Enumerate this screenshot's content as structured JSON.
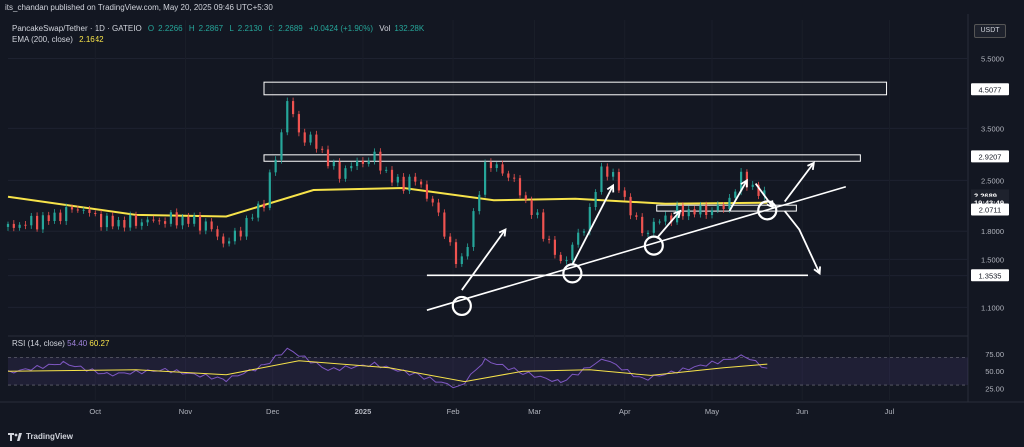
{
  "header": {
    "publisher": "its_chandan published on TradingView.com, May 20, 2025 09:46 UTC+5:30"
  },
  "legend": {
    "symbol": "PancakeSwap/Tether · 1D · GATEIO",
    "o_label": "O",
    "o_value": "2.2266",
    "h_label": "H",
    "h_value": "2.2867",
    "l_label": "L",
    "l_value": "2.2130",
    "c_label": "C",
    "c_value": "2.2689",
    "change": "+0.0424 (+1.90%)",
    "vol_label": "Vol",
    "vol_value": "132.28K",
    "ema_label": "EMA (200, close)",
    "ema_value": "2.1642"
  },
  "currency_badge": "USDT",
  "rsi_legend": {
    "label": "RSI (14, close)",
    "rsi_value": "54.40",
    "ma_value": "60.27"
  },
  "footer": {
    "brand": "TradingView"
  },
  "colors": {
    "background": "#131722",
    "up": "#26a69a",
    "down": "#ef5350",
    "ema": "#f7e34a",
    "rsi": "#7e57c2",
    "annotation": "#ffffff"
  },
  "chart_data": [
    {
      "type": "candlestick",
      "title": "PancakeSwap/Tether · 1D · GATEIO",
      "y_scale": "log",
      "ylim": [
        0.95,
        6.2
      ],
      "y_ticks": [
        "5.5000",
        "3.5000",
        "2.5000",
        "1.8000",
        "1.5000",
        "1.3500",
        "1.1000"
      ],
      "x_ticks": [
        "Oct",
        "Nov",
        "Dec",
        "2025",
        "Feb",
        "Mar",
        "Apr",
        "May",
        "Jun",
        "Jul"
      ],
      "price_marks": [
        {
          "label": "4.5077",
          "value": 4.5077
        },
        {
          "label": "2.9207",
          "value": 2.9207
        },
        {
          "label": "2.2689",
          "value": 2.2689,
          "highlight": true
        },
        {
          "label": "19:43:49",
          "value": 2.165,
          "highlight": true
        },
        {
          "label": "2.0711",
          "value": 2.0711
        },
        {
          "label": "1.3535",
          "value": 1.3535
        }
      ],
      "close_path": [
        [
          "2024-09-01",
          1.85
        ],
        [
          "2024-09-15",
          1.95
        ],
        [
          "2024-09-25",
          2.1
        ],
        [
          "2024-10-05",
          1.9
        ],
        [
          "2024-10-20",
          1.92
        ],
        [
          "2024-10-30",
          1.95
        ],
        [
          "2024-11-08",
          1.88
        ],
        [
          "2024-11-15",
          1.65
        ],
        [
          "2024-11-22",
          1.9
        ],
        [
          "2024-11-28",
          2.2
        ],
        [
          "2024-12-03",
          3.1
        ],
        [
          "2024-12-06",
          4.2
        ],
        [
          "2024-12-10",
          3.4
        ],
        [
          "2024-12-17",
          3.1
        ],
        [
          "2024-12-23",
          2.6
        ],
        [
          "2024-12-30",
          2.8
        ],
        [
          "2025-01-05",
          2.9
        ],
        [
          "2025-01-12",
          2.45
        ],
        [
          "2025-01-20",
          2.5
        ],
        [
          "2025-01-27",
          2.0
        ],
        [
          "2025-02-03",
          1.4
        ],
        [
          "2025-02-08",
          1.95
        ],
        [
          "2025-02-12",
          2.8
        ],
        [
          "2025-02-20",
          2.6
        ],
        [
          "2025-03-01",
          2.0
        ],
        [
          "2025-03-10",
          1.45
        ],
        [
          "2025-03-18",
          1.85
        ],
        [
          "2025-03-25",
          2.8
        ],
        [
          "2025-03-31",
          2.3
        ],
        [
          "2025-04-07",
          1.78
        ],
        [
          "2025-04-14",
          1.95
        ],
        [
          "2025-04-21",
          2.05
        ],
        [
          "2025-04-28",
          2.05
        ],
        [
          "2025-05-05",
          2.1
        ],
        [
          "2025-05-12",
          2.6
        ],
        [
          "2025-05-16",
          2.3
        ],
        [
          "2025-05-20",
          2.2689
        ]
      ],
      "ema_200": [
        [
          "2024-09-01",
          2.25
        ],
        [
          "2024-10-15",
          2.0
        ],
        [
          "2024-11-15",
          1.98
        ],
        [
          "2024-12-15",
          2.35
        ],
        [
          "2025-01-15",
          2.38
        ],
        [
          "2025-02-15",
          2.2
        ],
        [
          "2025-03-15",
          2.22
        ],
        [
          "2025-04-15",
          2.15
        ],
        [
          "2025-05-20",
          2.1642
        ]
      ],
      "zones": [
        {
          "from": "2024-11-28",
          "to": "2025-06-30",
          "top": 4.72,
          "bottom": 4.35
        },
        {
          "from": "2024-11-28",
          "to": "2025-06-21",
          "top": 2.95,
          "bottom": 2.83
        },
        {
          "from": "2025-04-12",
          "to": "2025-05-30",
          "top": 2.13,
          "bottom": 2.05
        }
      ],
      "support_line": {
        "value": 1.3535,
        "from": "2025-01-23",
        "to": "2025-06-03"
      },
      "trendline": [
        [
          "2025-01-23",
          1.08
        ],
        [
          "2025-06-16",
          2.4
        ]
      ],
      "touch_circles": [
        [
          "2025-02-04",
          1.11
        ],
        [
          "2025-03-14",
          1.37
        ],
        [
          "2025-04-11",
          1.64
        ],
        [
          "2025-05-20",
          2.06
        ]
      ],
      "arrows": [
        [
          [
            "2025-02-04",
            1.23
          ],
          [
            "2025-02-19",
            1.82
          ]
        ],
        [
          [
            "2025-03-14",
            1.45
          ],
          [
            "2025-03-28",
            2.42
          ]
        ],
        [
          [
            "2025-04-12",
            1.72
          ],
          [
            "2025-04-20",
            2.05
          ]
        ],
        [
          [
            "2025-05-07",
            2.05
          ],
          [
            "2025-05-13",
            2.5
          ]
        ],
        [
          [
            "2025-05-16",
            2.45
          ],
          [
            "2025-05-22",
            2.1
          ]
        ],
        [
          [
            "2025-05-26",
            2.18
          ],
          [
            "2025-06-05",
            2.8
          ]
        ],
        [
          [
            "2025-05-26",
            2.05
          ],
          [
            "2025-05-31",
            1.82
          ],
          [
            "2025-06-07",
            1.37
          ]
        ]
      ]
    },
    {
      "type": "line",
      "title": "RSI (14, close)",
      "ylim": [
        20,
        85
      ],
      "y_ticks": [
        "75.00",
        "50.00",
        "25.00"
      ],
      "bands": {
        "upper": 70,
        "lower": 30
      },
      "series": [
        {
          "name": "RSI",
          "values": [
            [
              "2024-09-01",
              48
            ],
            [
              "2024-09-20",
              62
            ],
            [
              "2024-10-05",
              45
            ],
            [
              "2024-10-25",
              52
            ],
            [
              "2024-11-15",
              38
            ],
            [
              "2024-11-28",
              58
            ],
            [
              "2024-12-06",
              82
            ],
            [
              "2024-12-20",
              52
            ],
            [
              "2025-01-05",
              60
            ],
            [
              "2025-01-20",
              44
            ],
            [
              "2025-02-03",
              26
            ],
            [
              "2025-02-12",
              66
            ],
            [
              "2025-02-25",
              48
            ],
            [
              "2025-03-10",
              34
            ],
            [
              "2025-03-25",
              68
            ],
            [
              "2025-04-07",
              38
            ],
            [
              "2025-04-25",
              56
            ],
            [
              "2025-05-12",
              72
            ],
            [
              "2025-05-20",
              54.4
            ]
          ]
        },
        {
          "name": "MA",
          "values": [
            [
              "2024-09-01",
              50
            ],
            [
              "2024-10-15",
              52
            ],
            [
              "2024-11-15",
              45
            ],
            [
              "2024-12-10",
              65
            ],
            [
              "2025-01-10",
              55
            ],
            [
              "2025-02-05",
              35
            ],
            [
              "2025-02-25",
              50
            ],
            [
              "2025-03-20",
              52
            ],
            [
              "2025-04-10",
              44
            ],
            [
              "2025-05-05",
              55
            ],
            [
              "2025-05-20",
              60.27
            ]
          ]
        }
      ]
    }
  ]
}
